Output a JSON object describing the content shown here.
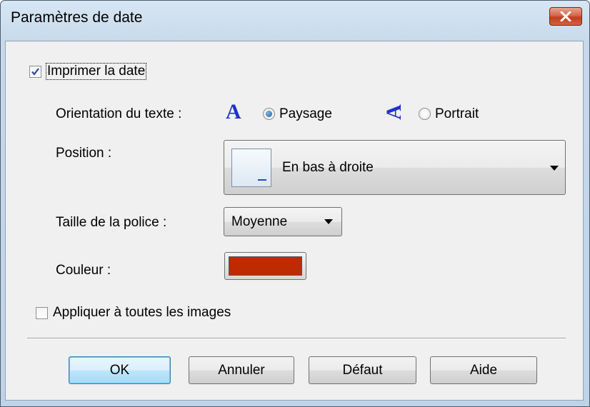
{
  "window": {
    "title": "Paramètres de date",
    "close_icon": "close-icon"
  },
  "print_date": {
    "label": "Imprimer la date",
    "checked": true
  },
  "orientation": {
    "label": "Orientation du texte :",
    "landscape_label": "Paysage",
    "portrait_label": "Portrait",
    "selected": "Paysage",
    "landscape_glyph": "A",
    "portrait_glyph": "A"
  },
  "position": {
    "label": "Position :",
    "value": "En bas à droite"
  },
  "font_size": {
    "label": "Taille de la police :",
    "value": "Moyenne"
  },
  "color": {
    "label": "Couleur :",
    "value": "#c02a00"
  },
  "apply_all": {
    "label": "Appliquer à toutes les images",
    "checked": false
  },
  "buttons": {
    "ok": "OK",
    "cancel": "Annuler",
    "default": "Défaut",
    "help": "Aide"
  }
}
